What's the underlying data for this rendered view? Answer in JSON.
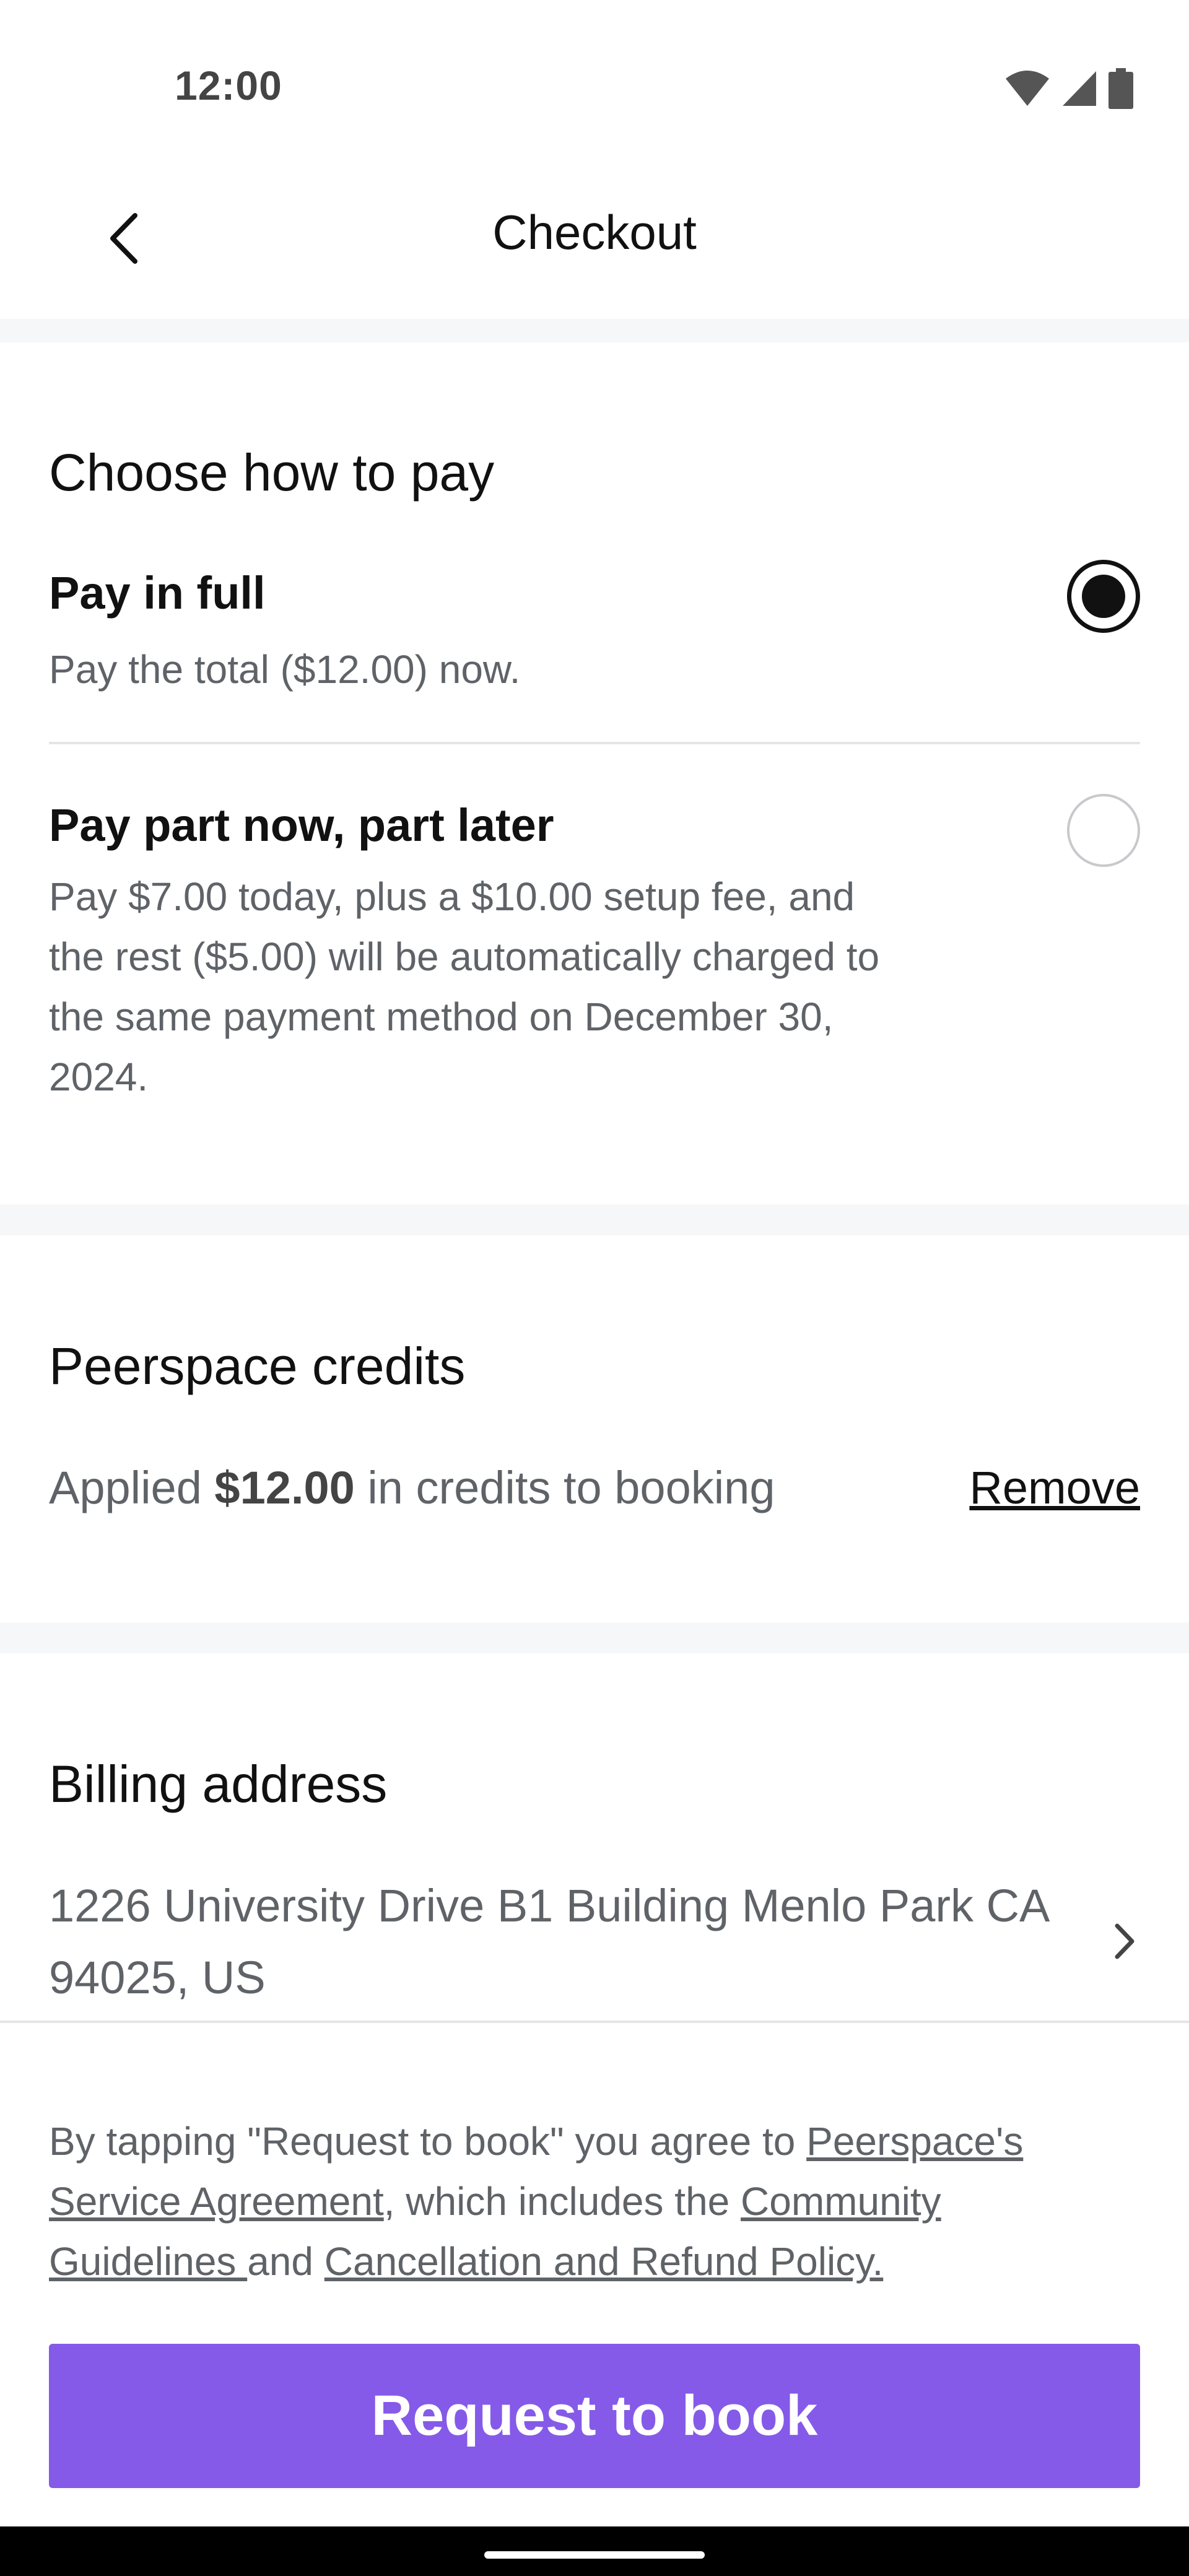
{
  "status_bar": {
    "time": "12:00",
    "icons": [
      "wifi-icon",
      "cellular-signal-icon",
      "battery-icon"
    ]
  },
  "header": {
    "title": "Checkout",
    "back_icon": "chevron-left-icon"
  },
  "payment": {
    "section_title": "Choose how to pay",
    "options": [
      {
        "title": "Pay in full",
        "description": "Pay the total ($12.00) now.",
        "selected": true
      },
      {
        "title": "Pay part now, part later",
        "description": "Pay $7.00 today, plus a $10.00 setup fee, and the rest ($5.00) will be automatically charged to the same payment method on December 30, 2024.",
        "selected": false
      }
    ]
  },
  "credits": {
    "section_title": "Peerspace credits",
    "applied_prefix": "Applied",
    "amount": "$12.00",
    "applied_suffix": "in credits to booking",
    "remove_label": "Remove"
  },
  "billing": {
    "section_title": "Billing address",
    "address": "1226 University Drive B1 Building Menlo Park CA 94025, US",
    "chevron_icon": "chevron-right-icon"
  },
  "legal": {
    "text_1": "By tapping \"Request to book\" you agree to ",
    "link_1": "Peerspace's Service Agreement",
    "text_2": ", which includes the ",
    "link_2": "Community Guidelines ",
    "text_3": "and ",
    "link_3": "Cancellation and Refund Policy."
  },
  "cta": {
    "label": "Request to book",
    "color": "#855ae8"
  }
}
